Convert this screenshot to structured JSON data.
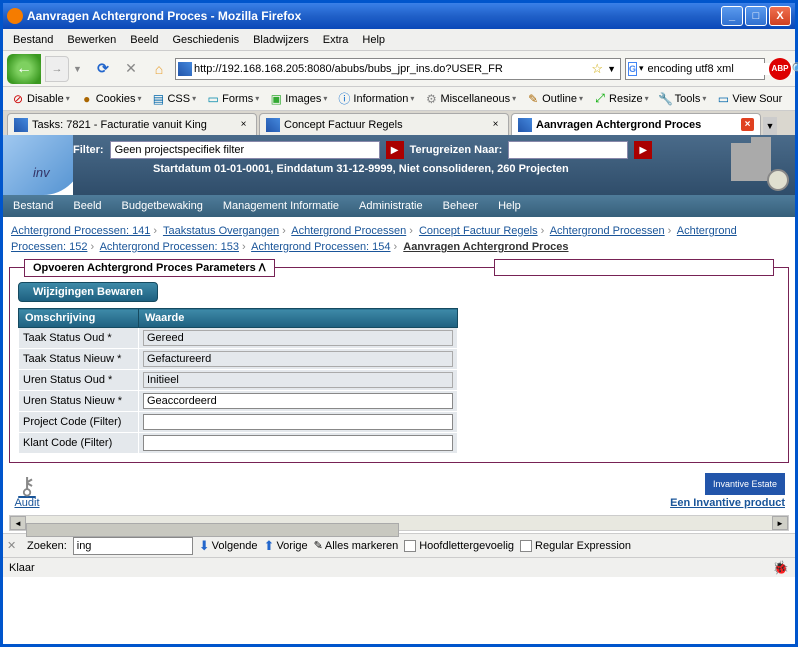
{
  "window": {
    "title": "Aanvragen Achtergrond Proces - Mozilla Firefox"
  },
  "menu": {
    "bestand": "Bestand",
    "bewerken": "Bewerken",
    "beeld": "Beeld",
    "geschiedenis": "Geschiedenis",
    "bladwijzers": "Bladwijzers",
    "extra": "Extra",
    "help": "Help"
  },
  "nav": {
    "url": "http://192.168.168.205:8080/abubs/bubs_jpr_ins.do?USER_FR",
    "search": "encoding utf8 xml"
  },
  "devbar": {
    "disable": "Disable",
    "cookies": "Cookies",
    "css": "CSS",
    "forms": "Forms",
    "images": "Images",
    "information": "Information",
    "miscellaneous": "Miscellaneous",
    "outline": "Outline",
    "resize": "Resize",
    "tools": "Tools",
    "viewsource": "View Sour"
  },
  "tabs": [
    {
      "label": "Tasks: 7821 - Facturatie vanuit King",
      "active": false
    },
    {
      "label": "Concept Factuur Regels",
      "active": false
    },
    {
      "label": "Aanvragen Achtergrond Proces",
      "active": true
    }
  ],
  "app": {
    "logo_text": "inv",
    "filter_label": "Filter:",
    "filter_value": "Geen projectspecifiek filter",
    "terug_label": "Terugreizen Naar:",
    "terug_value": "",
    "subheader": "Startdatum 01-01-0001, Einddatum 31-12-9999, Niet consolideren, 260 Projecten",
    "menu": {
      "bestand": "Bestand",
      "beeld": "Beeld",
      "budget": "Budgetbewaking",
      "mgmt": "Management Informatie",
      "admin": "Administratie",
      "beheer": "Beheer",
      "help": "Help"
    }
  },
  "crumbs": [
    {
      "label": "Achtergrond Processen: 141",
      "link": true
    },
    {
      "label": "Taakstatus Overgangen",
      "link": true
    },
    {
      "label": "Achtergrond Processen",
      "link": true
    },
    {
      "label": "Concept Factuur Regels",
      "link": true
    },
    {
      "label": "Achtergrond Processen",
      "link": true
    },
    {
      "label": "Achtergrond Processen: 152",
      "link": true
    },
    {
      "label": "Achtergrond Processen: 153",
      "link": true
    },
    {
      "label": "Achtergrond Processen: 154",
      "link": true
    },
    {
      "label": "Aanvragen Achtergrond Proces",
      "link": false
    }
  ],
  "fieldset": {
    "legend": "Opvoeren Achtergrond Proces Parameters",
    "save": "Wijzigingen Bewaren",
    "headers": {
      "col1": "Omschrijving",
      "col2": "Waarde"
    },
    "rows": [
      {
        "label": "Taak Status Oud *",
        "value": "Gereed",
        "readonly": true
      },
      {
        "label": "Taak Status Nieuw *",
        "value": "Gefactureerd",
        "readonly": true
      },
      {
        "label": "Uren Status Oud *",
        "value": "Initieel",
        "readonly": true
      },
      {
        "label": "Uren Status Nieuw *",
        "value": "Geaccordeerd",
        "readonly": false
      },
      {
        "label": "Project Code (Filter)",
        "value": "",
        "readonly": false
      },
      {
        "label": "Klant Code (Filter)",
        "value": "",
        "readonly": false
      }
    ]
  },
  "footer": {
    "audit": "Audit",
    "inv_logo": "Invantive Estate",
    "inv_link": "Een Invantive product"
  },
  "findbar": {
    "zoeken": "Zoeken:",
    "zoek_val": "ing",
    "volgende": "Volgende",
    "vorige": "Vorige",
    "alles": "Alles markeren",
    "hoofd": "Hoofdlettergevoelig",
    "regex": "Regular Expression"
  },
  "status": {
    "text": "Klaar"
  }
}
